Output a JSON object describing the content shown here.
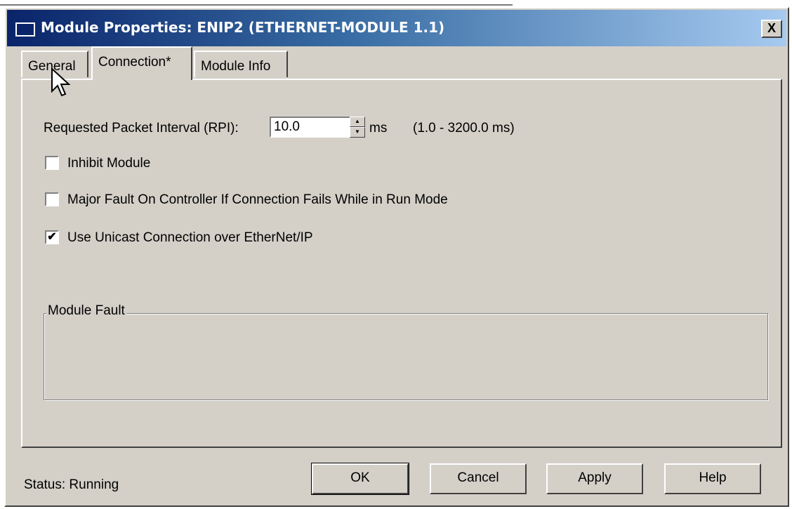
{
  "window": {
    "title": "Module Properties: ENIP2 (ETHERNET-MODULE 1.1)",
    "close_label": "X"
  },
  "tabs": [
    {
      "label": "General"
    },
    {
      "label": "Connection*"
    },
    {
      "label": "Module Info"
    }
  ],
  "connection": {
    "rpi_label": "Requested Packet Interval (RPI):",
    "rpi_value": "10.0",
    "rpi_unit": "ms",
    "rpi_range": "(1.0 - 3200.0 ms)",
    "checkboxes": [
      {
        "label": "Inhibit Module",
        "checked": false
      },
      {
        "label": "Major Fault On Controller If Connection Fails While in Run Mode",
        "checked": false
      },
      {
        "label": "Use Unicast Connection over EtherNet/IP",
        "checked": true
      }
    ],
    "module_fault_label": "Module Fault"
  },
  "footer": {
    "status_text": "Status:  Running",
    "buttons": {
      "ok": "OK",
      "cancel": "Cancel",
      "apply": "Apply",
      "help": "Help"
    }
  }
}
